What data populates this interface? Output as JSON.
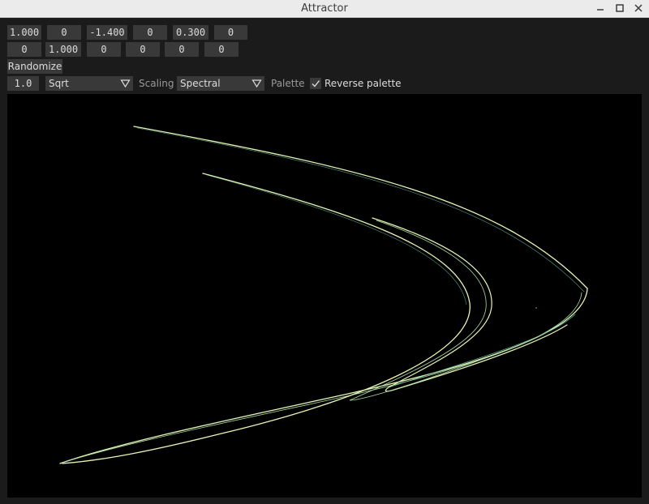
{
  "window": {
    "title": "Attractor",
    "controls": [
      "minimize-icon",
      "maximize-icon",
      "close-icon"
    ]
  },
  "params": {
    "row1": [
      "1.000",
      "0",
      "-1.400",
      "0",
      "0.300",
      "0"
    ],
    "row2": [
      "0",
      "1.000",
      "0",
      "0",
      "0",
      "0"
    ]
  },
  "randomize_label": "Randomize",
  "settings": {
    "exponent": "1.0",
    "scaling": {
      "selected": "Sqrt",
      "label": "Scaling"
    },
    "palette": {
      "selected": "Spectral",
      "label": "Palette"
    },
    "reverse_palette": {
      "label": "Reverse palette",
      "checked": true
    }
  },
  "colors": {
    "background": "#000000",
    "control_bg": "#393939",
    "control_text": "#dcdcdc",
    "label_text": "#9a9a9a",
    "curve_light": "#e6f5b4",
    "curve_mid": "#abdda4",
    "curve_blue": "#66c2a5"
  }
}
